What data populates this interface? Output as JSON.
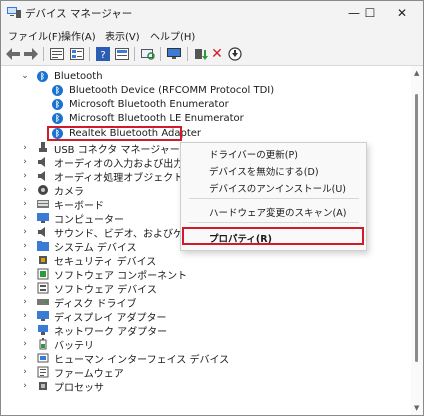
{
  "window": {
    "title": "デバイス マネージャー",
    "minimize": "—",
    "maximize": "☐",
    "close": "✕"
  },
  "menu": [
    "ファイル(F)",
    "操作(A)",
    "表示(V)",
    "ヘルプ(H)"
  ],
  "toolbar_icons": [
    "back-icon",
    "forward-icon",
    "properties-icon",
    "view-icon",
    "help-icon",
    "show-hidden-icon",
    "scan-icon",
    "monitor-icon",
    "update-driver-icon",
    "uninstall-icon",
    "download-icon"
  ],
  "tree": {
    "bluetooth": {
      "label": "Bluetooth",
      "children": [
        "Bluetooth Device (RFCOMM Protocol TDI)",
        "Microsoft Bluetooth Enumerator",
        "Microsoft Bluetooth LE Enumerator",
        "Realtek Bluetooth Adapter"
      ]
    },
    "categories": [
      "USB コネクタ マネージャー",
      "オーディオの入力および出力",
      "オーディオ処理オブジェクト (APO)",
      "カメラ",
      "キーボード",
      "コンピューター",
      "サウンド、ビデオ、およびゲーム コントローラー",
      "システム デバイス",
      "セキュリティ デバイス",
      "ソフトウェア コンポーネント",
      "ソフトウェア デバイス",
      "ディスク ドライブ",
      "ディスプレイ アダプター",
      "ネットワーク アダプター",
      "バッテリ",
      "ヒューマン インターフェイス デバイス",
      "ファームウェア",
      "プロセッサ"
    ]
  },
  "context_menu": {
    "update_driver": "ドライバーの更新(P)",
    "disable": "デバイスを無効にする(D)",
    "uninstall": "デバイスのアンインストール(U)",
    "scan": "ハードウェア変更のスキャン(A)",
    "properties": "プロパティ(R)"
  },
  "colors": {
    "highlight": "#d11a2a",
    "bluetooth": "#1a73d1"
  }
}
